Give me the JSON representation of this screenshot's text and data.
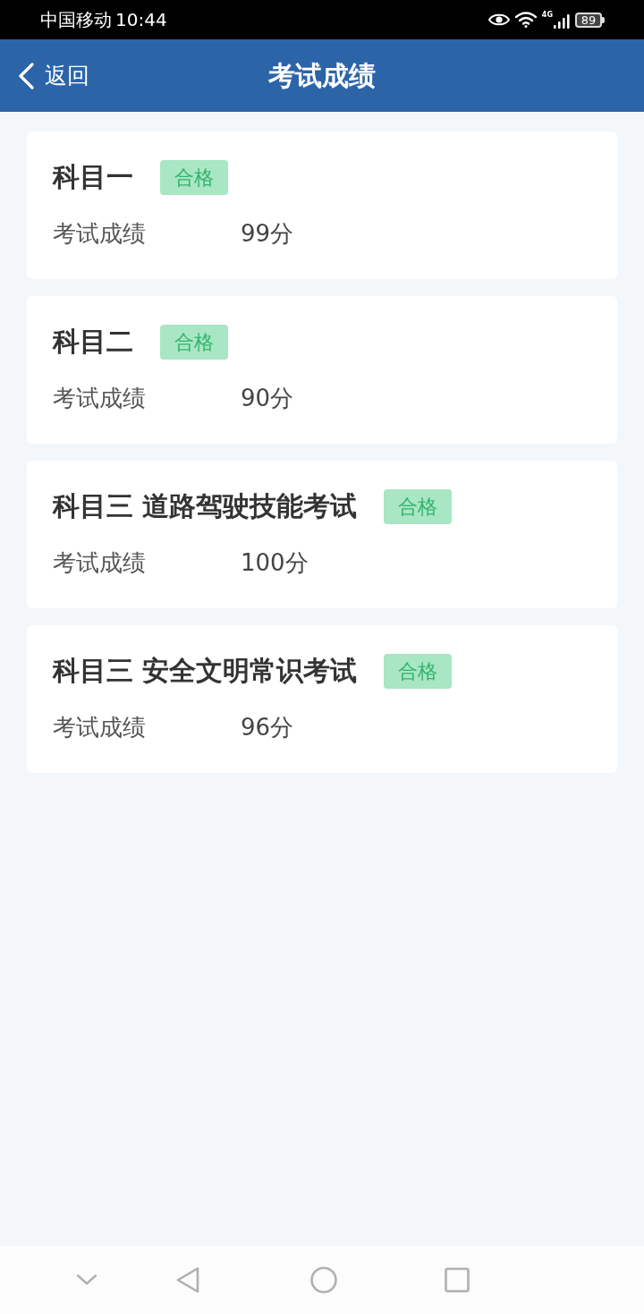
{
  "status_bar": {
    "carrier": "中国移动",
    "time": "10:44",
    "network": "4G",
    "battery": "89"
  },
  "header": {
    "back": "返回",
    "title": "考试成绩"
  },
  "subjects": [
    {
      "name": "科目一",
      "badge": "合格",
      "passed": true,
      "score_label": "考试成绩",
      "score": "99分"
    },
    {
      "name": "科目二",
      "badge": "合格",
      "passed": true,
      "score_label": "考试成绩",
      "score": "90分"
    },
    {
      "name": "科目三 道路驾驶技能考试",
      "badge": "合格",
      "passed": true,
      "score_label": "考试成绩",
      "score": "100分"
    },
    {
      "name": "科目三 安全文明常识考试",
      "badge": "合格",
      "passed": true,
      "score_label": "考试成绩",
      "score": "96分"
    }
  ]
}
